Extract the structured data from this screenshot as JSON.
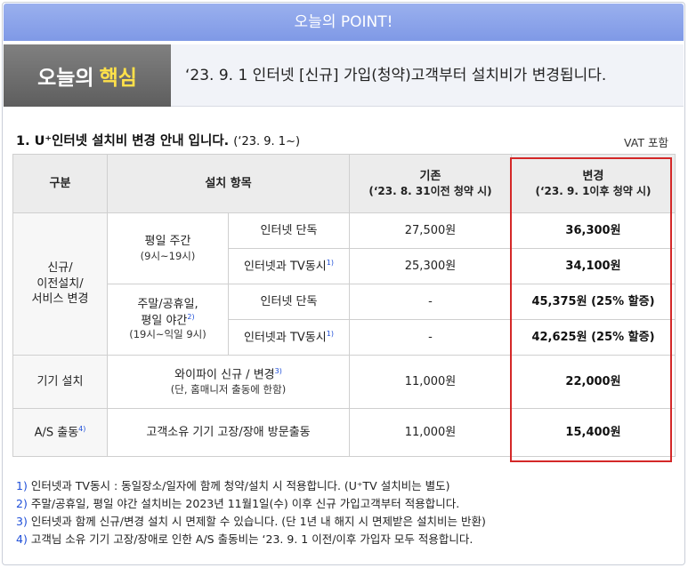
{
  "banner": {
    "title": "오늘의 POINT!"
  },
  "headline": {
    "badge_prefix": "오늘의",
    "badge_highlight": "핵심",
    "text": "‘23. 9. 1 인터넷 [신규] 가입(청약)고객부터 설치비가 변경됩니다."
  },
  "section": {
    "title": "1. U⁺인터넷 설치비 변경 안내 입니다.",
    "date": "(‘23. 9. 1~)",
    "vat": "VAT 포함"
  },
  "table": {
    "headers": {
      "category": "구분",
      "item": "설치 항목",
      "old": "기존",
      "old_sub": "(‘23. 8. 31이전 청약 시)",
      "new": "변경",
      "new_sub": "(‘23. 9. 1이후 청약 시)"
    },
    "groups": {
      "new_install": "신규/\n이전설치/\n서비스 변경",
      "weekday": "평일 주간",
      "weekday_time": "(9시~19시)",
      "weekend_line1": "주말/공휴일,",
      "weekend_line2": "평일 야간",
      "weekend_sup": "2)",
      "weekend_time": "(19시~익일 9시)",
      "device": "기기 설치",
      "as": "A/S 출동",
      "as_sup": "4)"
    },
    "rows": [
      {
        "item": "인터넷 단독",
        "sup": "",
        "old": "27,500원",
        "new": "36,300원"
      },
      {
        "item": "인터넷과 TV동시",
        "sup": "1)",
        "old": "25,300원",
        "new": "34,100원"
      },
      {
        "item": "인터넷 단독",
        "sup": "",
        "old": "-",
        "new": "45,375원 (25% 할증)"
      },
      {
        "item": "인터넷과 TV동시",
        "sup": "1)",
        "old": "-",
        "new": "42,625원 (25% 할증)"
      }
    ],
    "device_row": {
      "item": "와이파이 신규 / 변경",
      "sup": "3)",
      "item_note": "(단, 홈매니저 출동에 한함)",
      "old": "11,000원",
      "new": "22,000원"
    },
    "as_row": {
      "item": "고객소유 기기 고장/장애 방문출동",
      "old": "11,000원",
      "new": "15,400원"
    }
  },
  "footnotes": [
    {
      "num": "1)",
      "text": "인터넷과 TV동시 : 동일장소/일자에 함께 청약/설치 시 적용합니다. (U⁺TV 설치비는 별도)"
    },
    {
      "num": "2)",
      "text": "주말/공휴일, 평일 야간 설치비는 2023년 11월1일(수) 이후 신규 가입고객부터 적용합니다."
    },
    {
      "num": "3)",
      "text": "인터넷과 함께 신규/변경 설치 시 면제할 수 있습니다. (단 1년 내 해지 시 면제받은 설치비는 반환)"
    },
    {
      "num": "4)",
      "text": "고객님 소유 기기 고장/장애로 인한 A/S 출동비는 ‘23. 9. 1 이전/이후 가입자 모두 적용합니다."
    }
  ]
}
